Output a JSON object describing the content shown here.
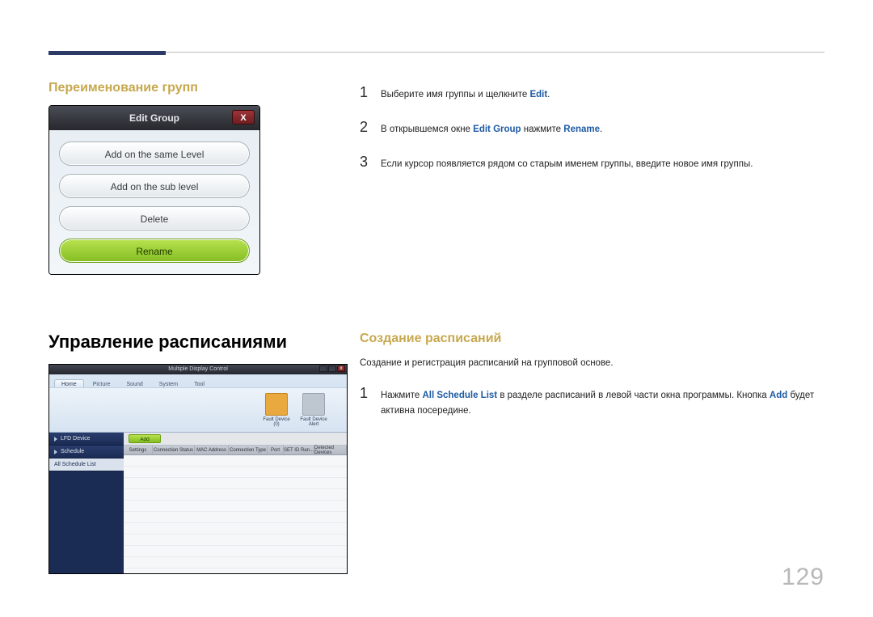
{
  "page_number": "129",
  "section1": {
    "heading": "Переименование групп",
    "dialog_title": "Edit Group",
    "buttons": {
      "same_level": "Add on the same Level",
      "sub_level": "Add on the sub level",
      "delete": "Delete",
      "rename": "Rename"
    },
    "steps": {
      "s1_a": "Выберите имя группы и щелкните ",
      "s1_kw": "Edit",
      "s1_b": ".",
      "s2_a": "В открывшемся окне ",
      "s2_kw1": "Edit Group",
      "s2_mid": " нажмите ",
      "s2_kw2": "Rename",
      "s2_b": ".",
      "s3": "Если курсор появляется рядом со старым именем группы, введите новое имя группы."
    }
  },
  "section2": {
    "heading": "Управление расписаниями",
    "sub_heading": "Создание расписаний",
    "intro": "Создание и регистрация расписаний на групповой основе.",
    "steps": {
      "s1_a": "Нажмите ",
      "s1_kw1": "All Schedule List",
      "s1_mid": " в разделе расписаний в левой части окна программы. Кнопка ",
      "s1_kw2": "Add",
      "s1_b": " будет активна посередине."
    },
    "mdc": {
      "title": "Multiple Display Control",
      "tabs": [
        "Home",
        "Picture",
        "Sound",
        "System",
        "Tool"
      ],
      "ribbon": [
        "Fault Device (0)",
        "Fault Device Alert"
      ],
      "side": [
        "LFD Device",
        "Schedule",
        "All Schedule List"
      ],
      "add": "Add",
      "columns": [
        "Settings",
        "Connection Status",
        "MAC Address",
        "Connection Type",
        "Port",
        "SET ID Ran...",
        "Detected Devices"
      ]
    }
  }
}
